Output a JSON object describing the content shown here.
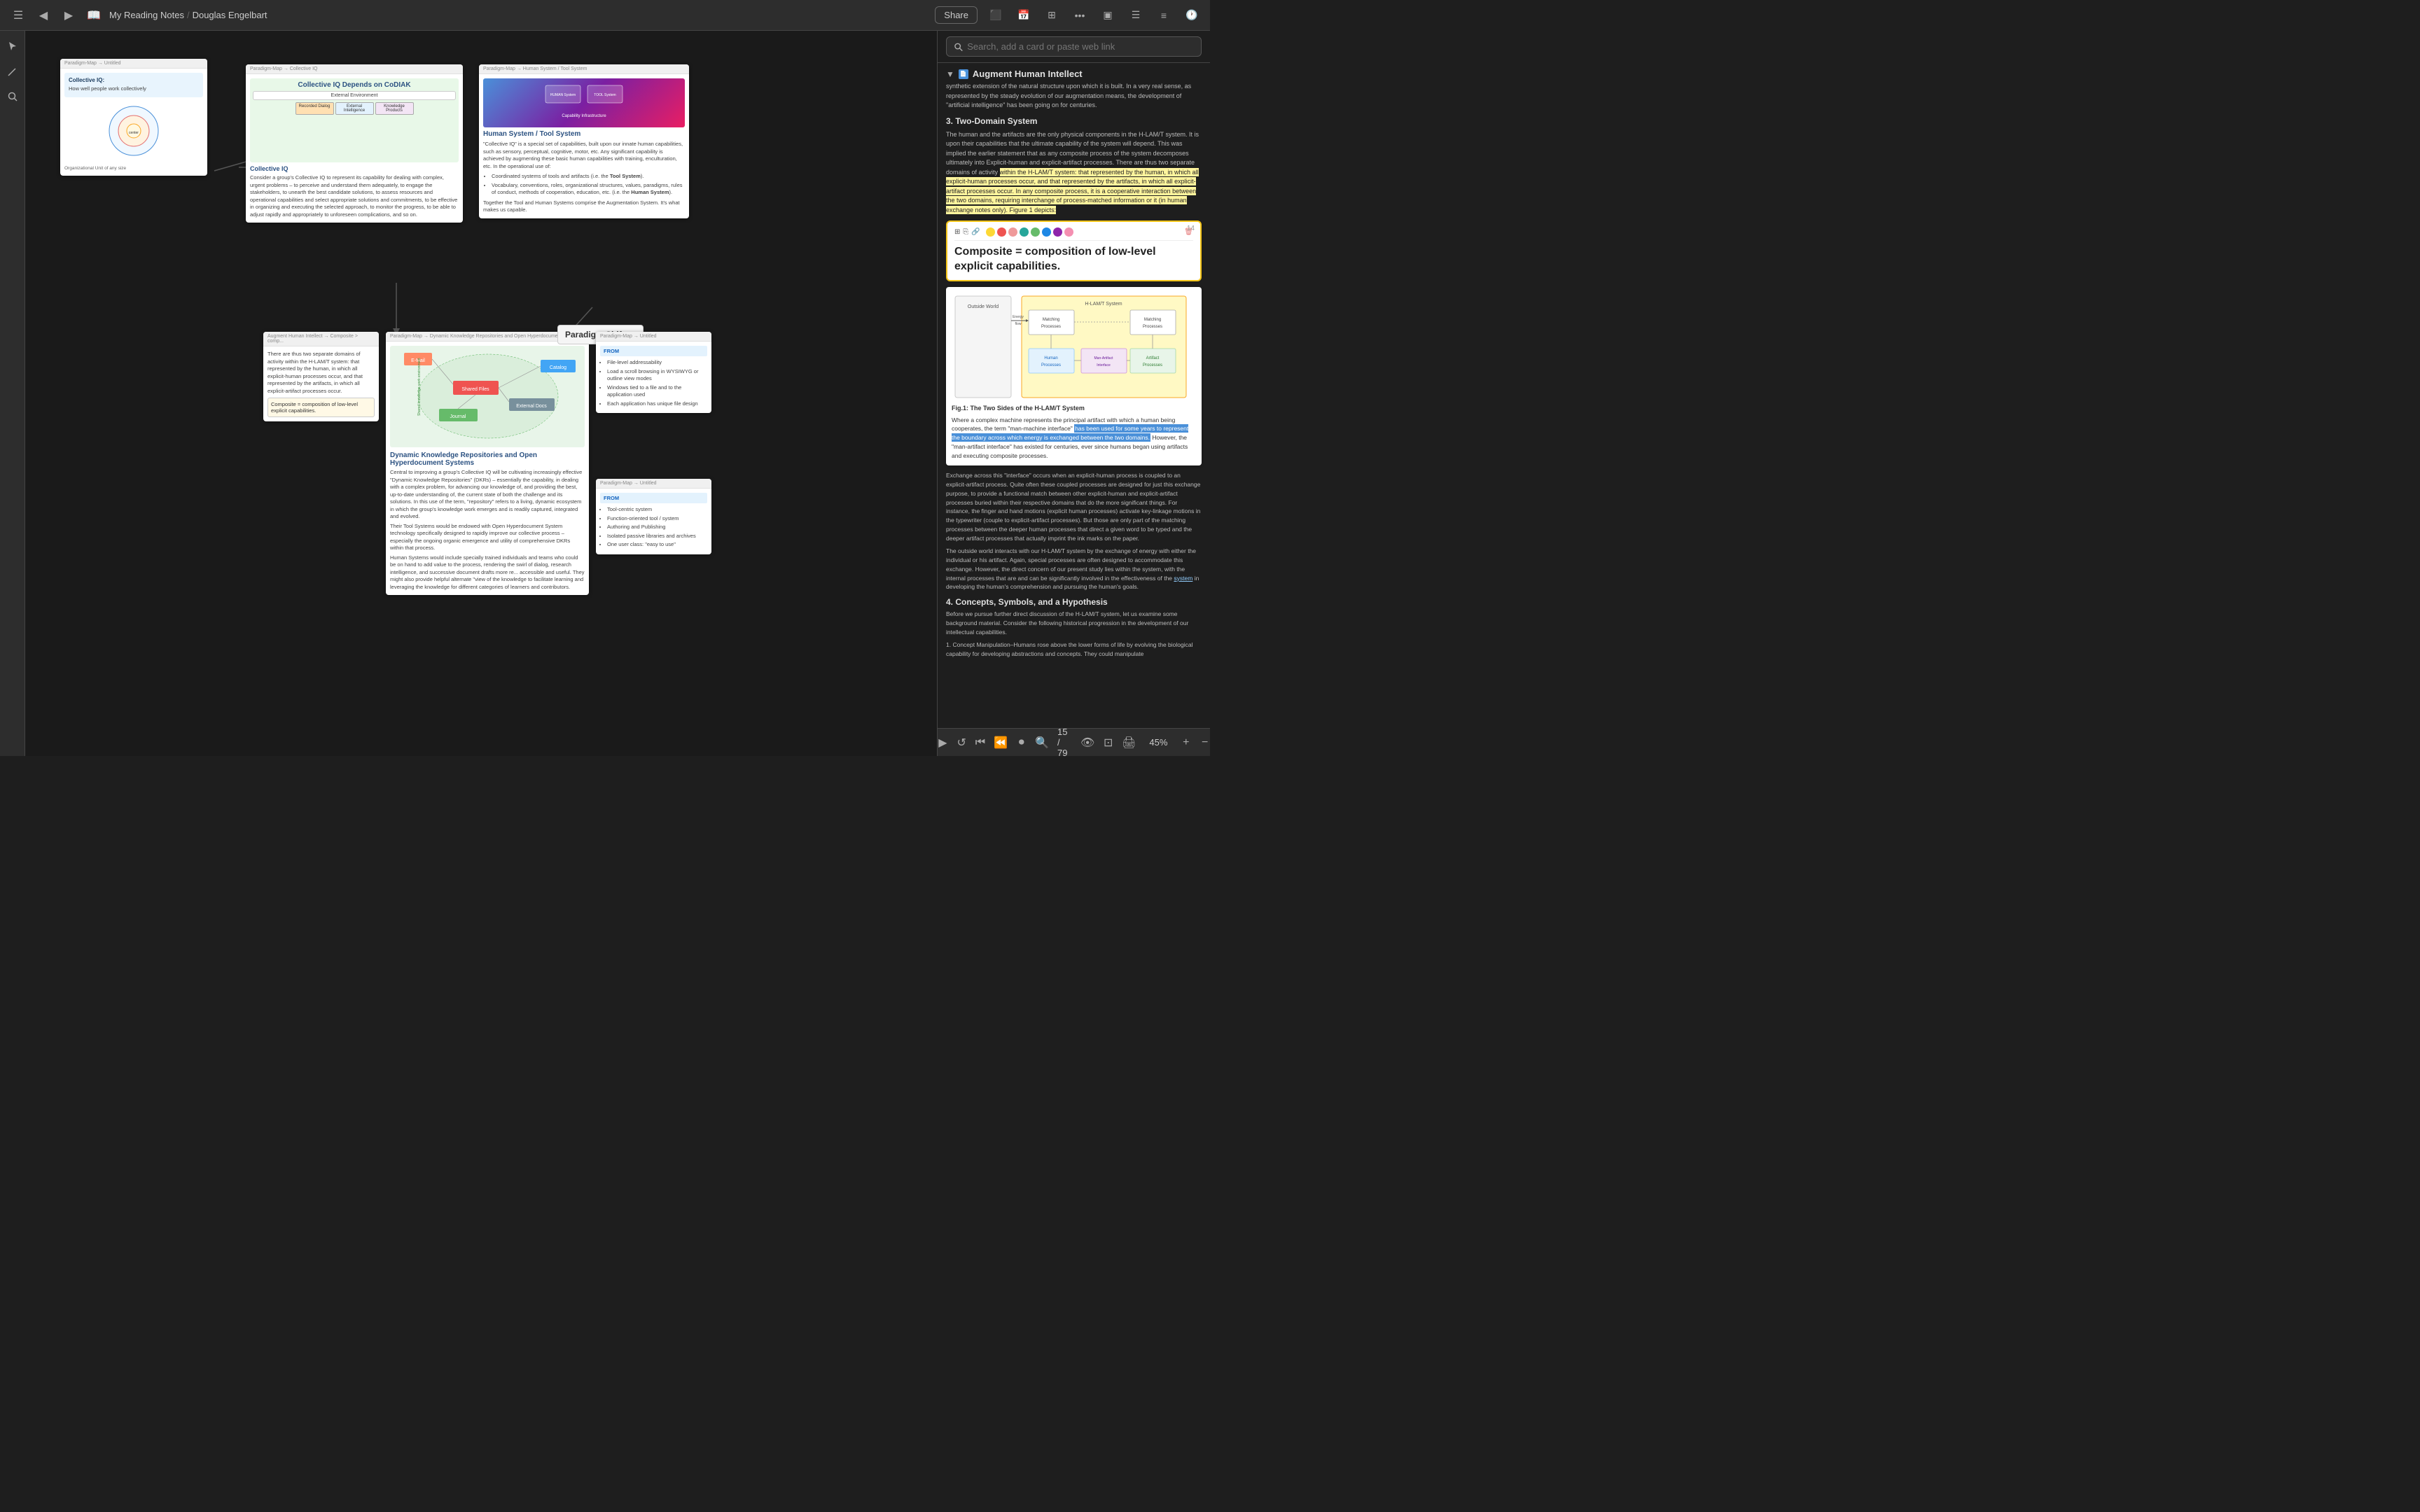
{
  "topbar": {
    "title": "My Reading Notes",
    "author": "Douglas Engelbart",
    "share_label": "Share",
    "back_icon": "◀",
    "forward_icon": "▶",
    "book_icon": "📖",
    "separator": "/",
    "icons": [
      "layers",
      "calendar",
      "grid",
      "more",
      "sidebar",
      "view",
      "list",
      "clock"
    ]
  },
  "search": {
    "placeholder": "Search, add a card or paste web link"
  },
  "right_panel": {
    "section_title": "Augment Human Intellect",
    "cards": [
      {
        "id": "card1",
        "breadcrumb": "Augment Human Intellect",
        "title": "Augment Human Intellect",
        "body_text": "synthetic extension of the natural structure upon which it is built. In a very real sense, as represented by the steady evolution of our augmentation means, the development of \"artificial intelligence\" has been going on for centuries.",
        "section_heading": "3. Two-Domain System",
        "section_body": "The human and the artifacts are the only physical components in the H-LAM/T system. It is upon their capabilities that the ultimate capability of the system will depend. This was implied the earlier statement that as any composite process of the system decomposes ultimately into Explicit-human and explicit-artifact processes. There are thus two separate domains of activity within the H-LAM/T system: that represented by the human, in which all explicit-human processes occur, and that represented by the artifacts, in which all explicit-artifact processes occur. In any composite process, it is a cooperative interaction between the two domains, requiring interchange of process-matched information or it (in human exchange notes only). Figure 1 depicts:",
        "highlight_yellow": "within the H-LAM/T system: that represented by the human, in which all explicit-human processes occur, and that represented by the artifacts, in which all explicit-artifact processes occur. In any composite process, it is a cooperative interaction between the two domains,",
        "has_annotation": true
      }
    ],
    "annotation": {
      "text": "Composite = composition of low-level explicit capabilities.",
      "page_num": "14"
    },
    "fig_caption": "Fig.1: The Two Sides of the H-LAM/T System",
    "fig_body": "Where a complex machine represents the principal artifact with which a human being cooperates, the term \"man-machine interface\" has been used for some years to represent the boundary across which energy is exchanged between the two domains. However, the \"man-artifact interface\" has existed for centuries, ever since humans began using artifacts and executing composite processes.",
    "fig_highlight": "the boundary across which energy is exchanged between the two domains",
    "section4_title": "4. Concepts, Symbols, and a Hypothesis",
    "section4_body": "Before we pursue further direct discussion of the H-LAM/T system, let us examine some background material. Consider the following historical progression in the development of our intellectual capabilities.",
    "section4_item1": "1. Concept Manipulation–Humans rose above the lower forms of life by evolving the biological capability for developing abstractions and concepts. They could manipulate",
    "page_indicator": "15 / 79"
  },
  "canvas": {
    "collective_iq_card": {
      "header": "Paradigm-Map → Collective IQ",
      "title": "Collective IQ Depends on CoDIAK",
      "subtitle": "Collective IQ",
      "body": "Consider a group's Collective IQ to represent its capability for dealing with complex, urgent problems – to perceive and understand them adequately, to engage the stakeholders, to unearth the best candidate solutions, to assess resources and operational capabilities and select appropriate solutions and commitments, to be effective in organizing and executing the selected approach, to monitor the progress, to be able to adjust rapidly and appropriately to unforeseen complications, and so on."
    },
    "human_system_card": {
      "header": "Paradigm-Map → Human System / Tool System",
      "title": "Human System / Tool System",
      "body": "\"Collective IQ\" is a special set of capabilities, built upon our innate human capabilities, such as sensory, perceptual, cognitive, motor, etc. Any significant capability is achieved by augmenting these basic human capabilities with training, enculturation, etc. In the operational use of:",
      "list": [
        "1. Coordinated systems of tools and artifacts (i.e. the Tool System).",
        "2. Vocabulary, conventions, roles, organizational structures, values, paradigms, rules of conduct, methods of cooperation, education, etc. (i.e. the Human System).",
        "Together the Tool and Human Systems comprise the Augmentation System. It's what makes us capable."
      ]
    },
    "composite_card": {
      "header": "Augment Human Intellect → Composite > comp...",
      "body": "There are thus two separate domains of activity within the H-LAM/T system: that represented by the human, in which all explicit-human processes occur, and that represented by the artifacts, in which all explicit-artifact processes occur.",
      "annotation": "Composite = composition of low-level explicit capabilities."
    },
    "dkr_card": {
      "header": "Paradigm-Map → Dynamic Knowledge Repositories and Open Hyperdocument Systems",
      "title": "Dynamic Knowledge Repositories and Open Hyperdocument Systems",
      "body": "Central to improving a group's Collective IQ will be cultivating increasingly effective \"Dynamic Knowledge Repositories\" (DKRs) – essentially the capability, in dealing with a complex problem, for advancing our knowledge of, and providing the best, up-to-date understanding of, the current state of both the challenge and its solutions. In this use of the term, \"repository\" refers to a living, dynamic ecosystem in which the group's knowledge work emerges and is readily captured, integrated and evolved.",
      "body2": "Their Tool Systems would be endowed with Open Hyperdocument System technology specifically designed to rapidly improve our collective process – especially the ongoing organic emergence and utility of comprehensive DKRs within that process.",
      "body3": "Human Systems would include specially trained individuals and teams who could be on hand to add value to the process, rendering the swirl of dialog, research intelligence, and successive document drafts more re... accessible and useful. They might also provide helpful alternate \"view of the knowledge to facilitate learning and leveraging the knowledge for different categories of learners and contributors."
    },
    "paradigm_shift": {
      "label": "Paradigm Shift",
      "icons": [
        "···"
      ]
    },
    "file_level_card": {
      "header": "Paradigm-Map → Untitled",
      "items": [
        "File-level addressability",
        "Load a scroll browsing in WYSIWYG or outline view modes",
        "Windows tied to a file and to the application used",
        "Each application has unique file design"
      ]
    },
    "tool_centric_card": {
      "header": "Paradigm-Map → Untitled",
      "items": [
        "Tool-centric system",
        "Function-oriented tool / system",
        "Authoring and Publishing",
        "Isolated passive libraries and archives",
        "One user class: \"easy to use\""
      ]
    },
    "main_card": {
      "header": "Paradigm-Map → Untitled",
      "title": "Collective IQ:",
      "subtitle": "How well people work collectively"
    }
  },
  "bottom_toolbar": {
    "zoom": "45%",
    "page": "15 / 79"
  },
  "colors": {
    "background": "#1e1e1e",
    "card_bg": "#ffffff",
    "panel_bg": "#1e1e1e",
    "accent_blue": "#4a90d9",
    "highlight_yellow": "#fff59d",
    "highlight_blue": "#bbdefb",
    "annotation_border": "#f0c040",
    "text_dark": "#222222",
    "text_light": "#cccccc"
  }
}
